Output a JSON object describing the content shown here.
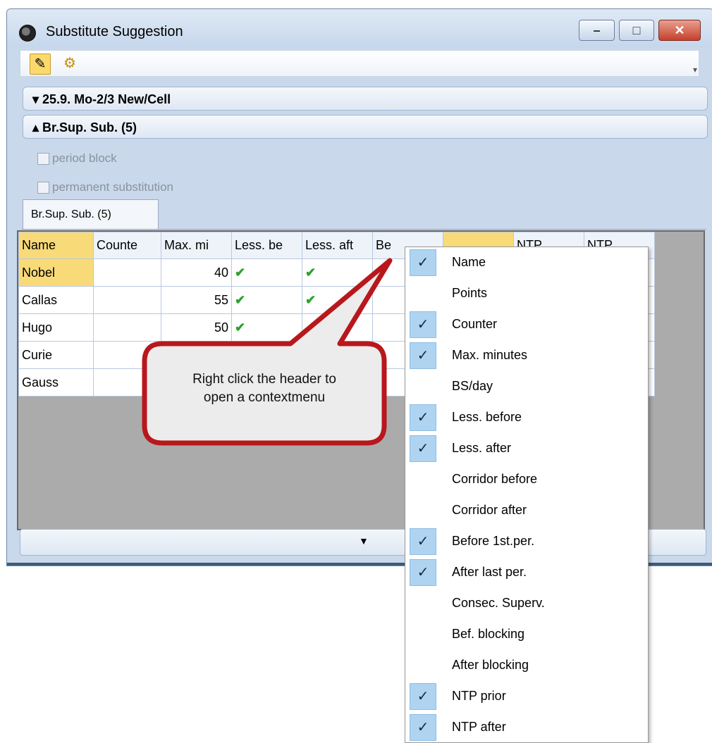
{
  "window": {
    "title": "Substitute Suggestion",
    "minimize_glyph": "–",
    "maximize_glyph": "□",
    "close_glyph": "✕"
  },
  "toolbar": {
    "active_tool_icon": "pencil-icon",
    "settings_icon": "gear-icon"
  },
  "panels": {
    "date_bar": "▾ 25.9. Mo-2/3 New/Cell",
    "sup_sub_bar": "▴ Br.Sup. Sub. (5)"
  },
  "options": {
    "period_block": "period block",
    "permanent_substitution": "permanent substitution"
  },
  "tabs": [
    {
      "label": "Br.Sup. Sub. (5)"
    }
  ],
  "grid": {
    "columns": [
      "Name",
      "Counte",
      "Max. mi",
      "Less. be",
      "Less. aft",
      "Be",
      "",
      "NTP",
      "NTP"
    ],
    "rows": [
      {
        "name": "Nobel",
        "counter": "",
        "max_minutes": "40",
        "less_before": "✔",
        "less_after": "✔",
        "before": ""
      },
      {
        "name": "Callas",
        "counter": "",
        "max_minutes": "55",
        "less_before": "✔",
        "less_after": "✔",
        "before": ""
      },
      {
        "name": "Hugo",
        "counter": "",
        "max_minutes": "50",
        "less_before": "✔",
        "less_after": "",
        "before": ""
      },
      {
        "name": "Curie",
        "counter": "",
        "max_minutes": "",
        "less_before": "",
        "less_after": "",
        "before": ""
      },
      {
        "name": "Gauss",
        "counter": "",
        "max_minutes": "",
        "less_before": "",
        "less_after": "",
        "before": "✔"
      }
    ]
  },
  "callout": {
    "line1": "Right click the header to",
    "line2": "open a contextmenu"
  },
  "context_menu": {
    "items": [
      {
        "label": "Name",
        "checked": true
      },
      {
        "label": "Points",
        "checked": false
      },
      {
        "label": "Counter",
        "checked": true
      },
      {
        "label": "Max. minutes",
        "checked": true
      },
      {
        "label": "BS/day",
        "checked": false
      },
      {
        "label": "Less. before",
        "checked": true
      },
      {
        "label": "Less. after",
        "checked": true
      },
      {
        "label": "Corridor before",
        "checked": false
      },
      {
        "label": "Corridor after",
        "checked": false
      },
      {
        "label": "Before 1st.per.",
        "checked": true
      },
      {
        "label": "After last per.",
        "checked": true
      },
      {
        "label": "Consec. Superv.",
        "checked": false
      },
      {
        "label": "Bef. blocking",
        "checked": false
      },
      {
        "label": "After blocking",
        "checked": false
      },
      {
        "label": "NTP prior",
        "checked": true
      },
      {
        "label": "NTP after",
        "checked": true
      }
    ]
  },
  "colors": {
    "callout_border": "#b8181c",
    "selection": "#f8da78",
    "menu_check": "#aed4f1",
    "check_green": "#2ea02e"
  }
}
